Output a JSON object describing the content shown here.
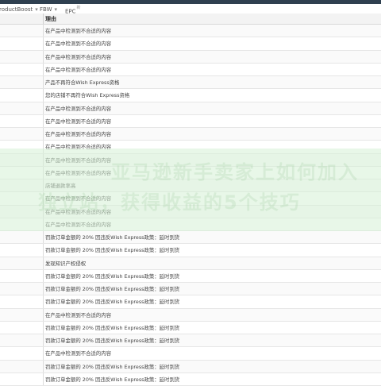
{
  "nav": {
    "items": [
      {
        "label": "roductBoost",
        "caret": "▾"
      },
      {
        "label": "FBW",
        "caret": "▾"
      },
      {
        "label": "EPC",
        "sup": "新"
      }
    ]
  },
  "table": {
    "header": "理由",
    "rows": [
      "在产品中检测到不合适的内容",
      "在产品中检测到不合适的内容",
      "在产品中检测到不合适的内容",
      "在产品中检测到不合适的内容",
      "产品不再符合Wish Express资格",
      "您的店铺不再符合Wish Express资格",
      "在产品中检测到不合适的内容",
      "在产品中检测到不合适的内容",
      "在产品中检测到不合适的内容",
      "在产品中检测到不合适的内容",
      "在产品中检测到不合适的内容",
      "在产品中检测到不合适的内容",
      "店铺退款率高",
      "在产品中检测到不合适的内容",
      "在产品中检测到不合适的内容",
      "在产品中检测到不合适的内容",
      "罚款订单金额的 20% 因违反Wish Express政策：延时到货",
      "罚款订单金额的 20% 因违反Wish Express政策：延时到货",
      "发现知识产权侵权",
      "罚款订单金额的 20% 因违反Wish Express政策：延时到货",
      "罚款订单金额的 20% 因违反Wish Express政策：延时到货",
      "罚款订单金额的 20% 因违反Wish Express政策：延时到货",
      "在产品中检测到不合适的内容",
      "罚款订单金额的 20% 因违反Wish Express政策：延时到货",
      "罚款订单金额的 20% 因违反Wish Express政策：延时到货",
      "在产品中检测到不合适的内容",
      "罚款订单金额的 20% 因违反Wish Express政策：延时到货",
      "罚款订单金额的 20% 因违反Wish Express政策：延时到货"
    ]
  },
  "watermark": {
    "line1": "亚马逊新手卖家上如何加入",
    "line2": "独立站，获得收益的5个技巧"
  },
  "colors": {
    "topbar": "#2f4050",
    "watermark_band": "#d6f0d6"
  }
}
